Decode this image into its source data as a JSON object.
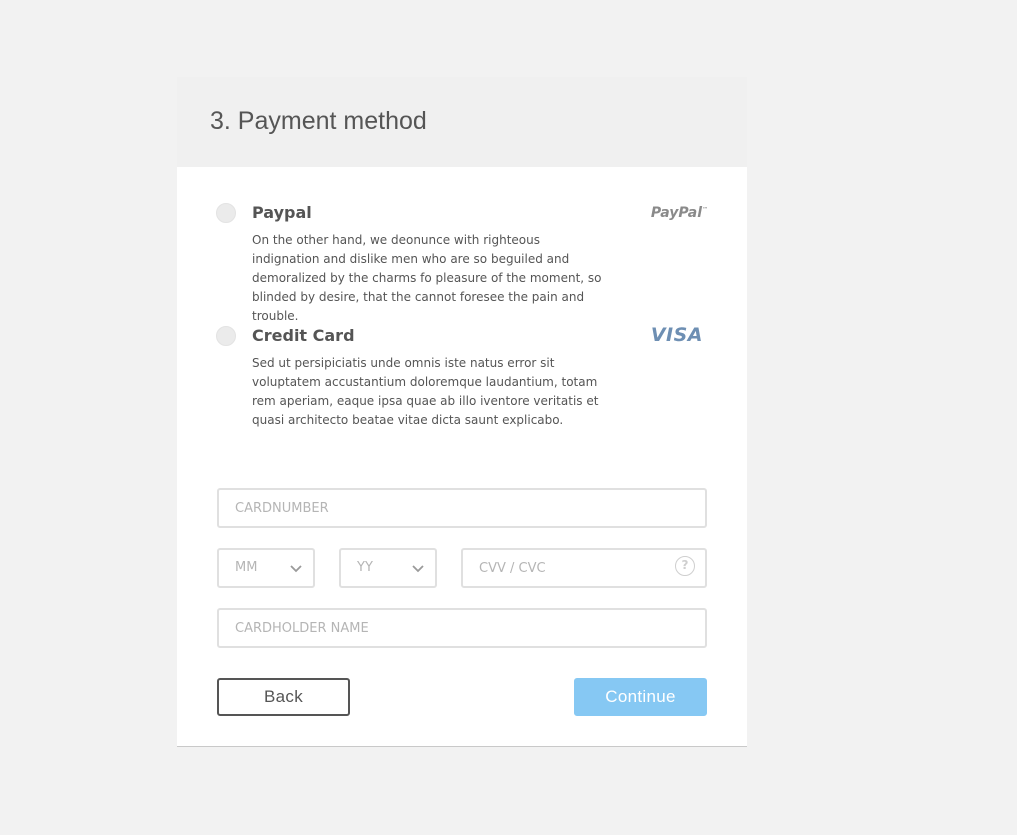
{
  "header": {
    "title": "3. Payment method"
  },
  "options": [
    {
      "title": "Paypal",
      "brand": "PayPal",
      "brand_mark": "™",
      "description": "On the other hand, we deonunce with righteous indignation and dislike men who are so beguiled and demoralized by the charms fo pleasure of the moment, so blinded by desire, that the cannot foresee the pain and trouble."
    },
    {
      "title": "Credit Card",
      "brand": "VISA",
      "description": "Sed ut persipiciatis unde omnis iste natus error sit voluptatem accustantium doloremque laudantium, totam rem aperiam, eaque ipsa quae ab illo iventore veritatis et quasi architecto beatae vitae dicta saunt explicabo."
    }
  ],
  "form": {
    "card_number_placeholder": "CARDNUMBER",
    "month_placeholder": "MM",
    "year_placeholder": "YY",
    "cvv_placeholder": "CVV / CVC",
    "help_icon_glyph": "?",
    "cardholder_placeholder": "CARDHOLDER NAME"
  },
  "actions": {
    "back_label": "Back",
    "continue_label": "Continue"
  },
  "colors": {
    "page_bg": "#f2f2f2",
    "header_bg": "#f0f0f0",
    "text": "#555555",
    "continue_bg": "#86c8f3",
    "visa_brand": "#6e8fb3"
  },
  "icons": {
    "help": "question-circle-icon",
    "select_arrow": "chevron-down-icon"
  }
}
